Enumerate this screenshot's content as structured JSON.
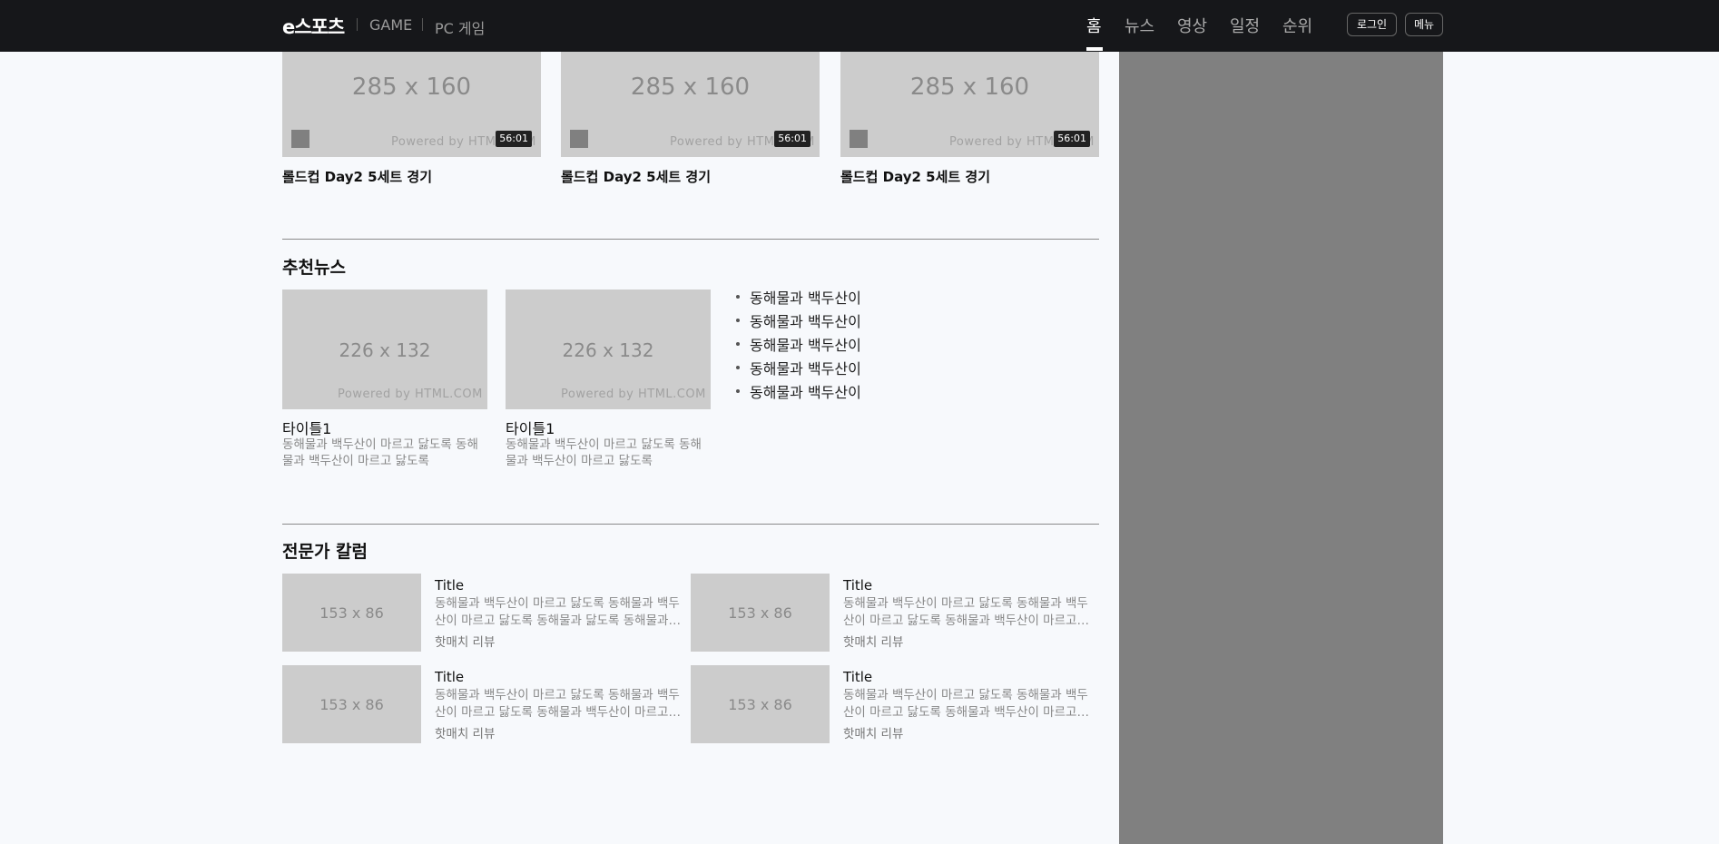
{
  "header": {
    "logo": "e스포츠",
    "sub_links": [
      "GAME",
      "PC 게임"
    ],
    "menu": [
      "홈",
      "뉴스",
      "영상",
      "일정",
      "순위"
    ],
    "active_menu": "홈",
    "login_label": "로그인",
    "menu_label": "메뉴"
  },
  "videos": [
    {
      "placeholder": "285 x 160",
      "powered": "Powered by HTML.COM",
      "duration": "56:01",
      "title": "롤드컵 Day2 5세트 경기"
    },
    {
      "placeholder": "285 x 160",
      "powered": "Powered by HTML.COM",
      "duration": "56:01",
      "title": "롤드컵 Day2 5세트 경기"
    },
    {
      "placeholder": "285 x 160",
      "powered": "Powered by HTML.COM",
      "duration": "56:01",
      "title": "롤드컵 Day2 5세트 경기"
    }
  ],
  "recommended_news": {
    "heading": "추천뉴스",
    "cards": [
      {
        "placeholder": "226 x 132",
        "powered": "Powered by HTML.COM",
        "title": "타이틀1",
        "desc": "동해물과 백두산이 마르고 닳도록 동해물과 백두산이 마르고 닳도록"
      },
      {
        "placeholder": "226 x 132",
        "powered": "Powered by HTML.COM",
        "title": "타이틀1",
        "desc": "동해물과 백두산이 마르고 닳도록 동해물과 백두산이 마르고 닳도록"
      }
    ],
    "list": [
      "동해물과 백두산이",
      "동해물과 백두산이",
      "동해물과 백두산이",
      "동해물과 백두산이",
      "동해물과 백두산이"
    ]
  },
  "expert_column": {
    "heading": "전문가 칼럼",
    "cards": [
      {
        "placeholder": "153 x 86",
        "title": "Title",
        "desc": "동해물과 백두산이 마르고 닳도록 동해물과 백두산이 마르고 닳도록 동해물과 닳도록 동해물과 백두산이",
        "tag": "핫매치 리뷰"
      },
      {
        "placeholder": "153 x 86",
        "title": "Title",
        "desc": "동해물과 백두산이 마르고 닳도록 동해물과 백두산이 마르고 닳도록 동해물과 백두산이 마르고 닳도록",
        "tag": "핫매치 리뷰"
      },
      {
        "placeholder": "153 x 86",
        "title": "Title",
        "desc": "동해물과 백두산이 마르고 닳도록 동해물과 백두산이 마르고 닳도록 동해물과 백두산이 마르고 닳도록",
        "tag": "핫매치 리뷰"
      },
      {
        "placeholder": "153 x 86",
        "title": "Title",
        "desc": "동해물과 백두산이 마르고 닳도록 동해물과 백두산이 마르고 닳도록 동해물과 백두산이 마르고 닳도록",
        "tag": "핫매치 리뷰"
      }
    ]
  }
}
